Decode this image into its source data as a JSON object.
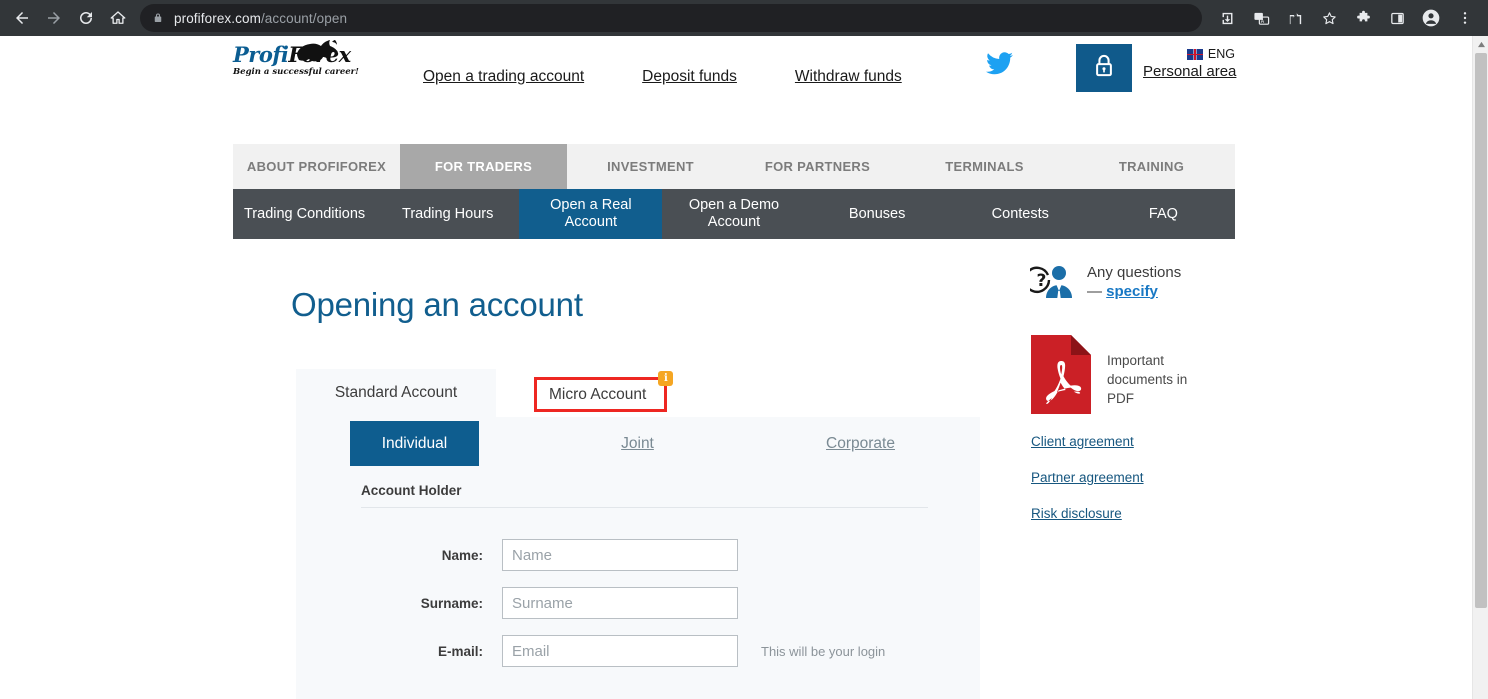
{
  "browser": {
    "url_host": "profiforex.com",
    "url_path": "/account/open",
    "back_icon": "back-arrow-icon",
    "forward_icon": "forward-arrow-icon",
    "reload_icon": "reload-icon",
    "home_icon": "home-icon",
    "lock_icon": "lock-icon",
    "install_icon": "install-app-icon",
    "translate_icon": "translate-icon",
    "share_icon": "share-icon",
    "bookmark_icon": "star-icon",
    "extensions_icon": "puzzle-extensions-icon",
    "sidepanel_icon": "side-panel-icon",
    "profile_icon": "profile-avatar-icon",
    "menu_icon": "three-dot-menu-icon"
  },
  "site_header": {
    "logo_profi": "Profi",
    "logo_forex": "Forex",
    "logo_tagline": "Begin a successful career!",
    "links": [
      "Open a trading account",
      "Deposit funds",
      "Withdraw funds"
    ],
    "twitter_icon": "twitter-bird-icon",
    "lock_button_icon": "padlock-icon",
    "language": "ENG",
    "personal_area": "Personal area"
  },
  "main_nav": {
    "items": [
      {
        "label": "ABOUT PROFIFOREX",
        "active": false
      },
      {
        "label": "FOR TRADERS",
        "active": true
      },
      {
        "label": "INVESTMENT",
        "active": false
      },
      {
        "label": "FOR PARTNERS",
        "active": false
      },
      {
        "label": "TERMINALS",
        "active": false
      },
      {
        "label": "TRAINING",
        "active": false
      }
    ]
  },
  "sub_nav": {
    "items": [
      {
        "label": "Trading Conditions",
        "active": false
      },
      {
        "label": "Trading Hours",
        "active": false
      },
      {
        "label": "Open a Real Account",
        "active": true
      },
      {
        "label": "Open a Demo Account",
        "active": false
      },
      {
        "label": "Bonuses",
        "active": false
      },
      {
        "label": "Contests",
        "active": false
      },
      {
        "label": "FAQ",
        "active": false
      }
    ]
  },
  "content": {
    "title": "Opening an account",
    "account_tabs": {
      "standard": "Standard Account",
      "micro": "Micro Account",
      "micro_badge": "i"
    },
    "holder_tabs": [
      {
        "label": "Individual",
        "active": true
      },
      {
        "label": "Joint",
        "active": false
      },
      {
        "label": "Corporate",
        "active": false
      }
    ],
    "section_label": "Account Holder",
    "fields": [
      {
        "label": "Name:",
        "placeholder": "Name",
        "value": "",
        "hint": ""
      },
      {
        "label": "Surname:",
        "placeholder": "Surname",
        "value": "",
        "hint": ""
      },
      {
        "label": "E-mail:",
        "placeholder": "Email",
        "value": "",
        "hint": "This will be your login"
      }
    ]
  },
  "sidebar": {
    "questions_icon": "question-person-icon",
    "questions_line1": "Any questions",
    "questions_dash": "— ",
    "questions_link": "specify",
    "pdf_icon": "pdf-document-icon",
    "pdf_text": "Important documents in PDF",
    "doc_links": [
      "Client agreement",
      "Partner agreement",
      "Risk disclosure"
    ]
  },
  "colors": {
    "brand_blue": "#115e8e",
    "highlight_red": "#ee2722",
    "badge_orange": "#f5a623",
    "pdf_red": "#cb2026",
    "subnav_gray": "#4a4f54"
  }
}
